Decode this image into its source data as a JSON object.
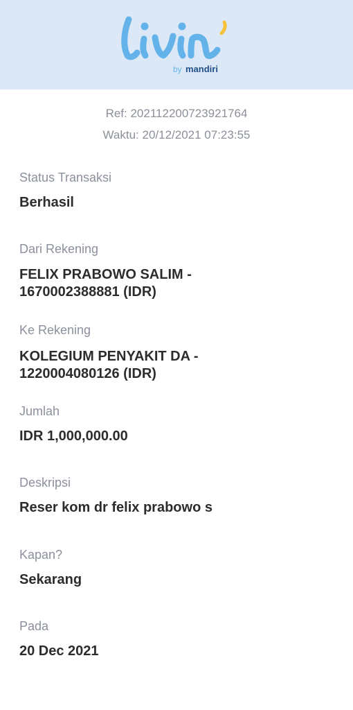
{
  "header": {
    "brand_wordmark": "livin'",
    "brand_sub_prefix": "by",
    "brand_sub_name": "mandiri",
    "brand_color": "#63b3ea",
    "accent_color": "#f7c33c"
  },
  "receipt": {
    "ref": "Ref: 202112200723921764",
    "time": "Waktu: 20/12/2021 07:23:55"
  },
  "fields": {
    "status_label": "Status Transaksi",
    "status_value": "Berhasil",
    "from_label": "Dari Rekening",
    "from_value_line1": "FELIX PRABOWO SALIM -",
    "from_value_line2": "1670002388881 (IDR)",
    "to_label": "Ke Rekening",
    "to_value_line1": "KOLEGIUM PENYAKIT DA -",
    "to_value_line2": "1220004080126 (IDR)",
    "amount_label": "Jumlah",
    "amount_value": "IDR 1,000,000.00",
    "desc_label": "Deskripsi",
    "desc_value": "Reser kom dr felix prabowo s",
    "when_label": "Kapan?",
    "when_value": "Sekarang",
    "on_label": "Pada",
    "on_value": "20 Dec 2021"
  }
}
